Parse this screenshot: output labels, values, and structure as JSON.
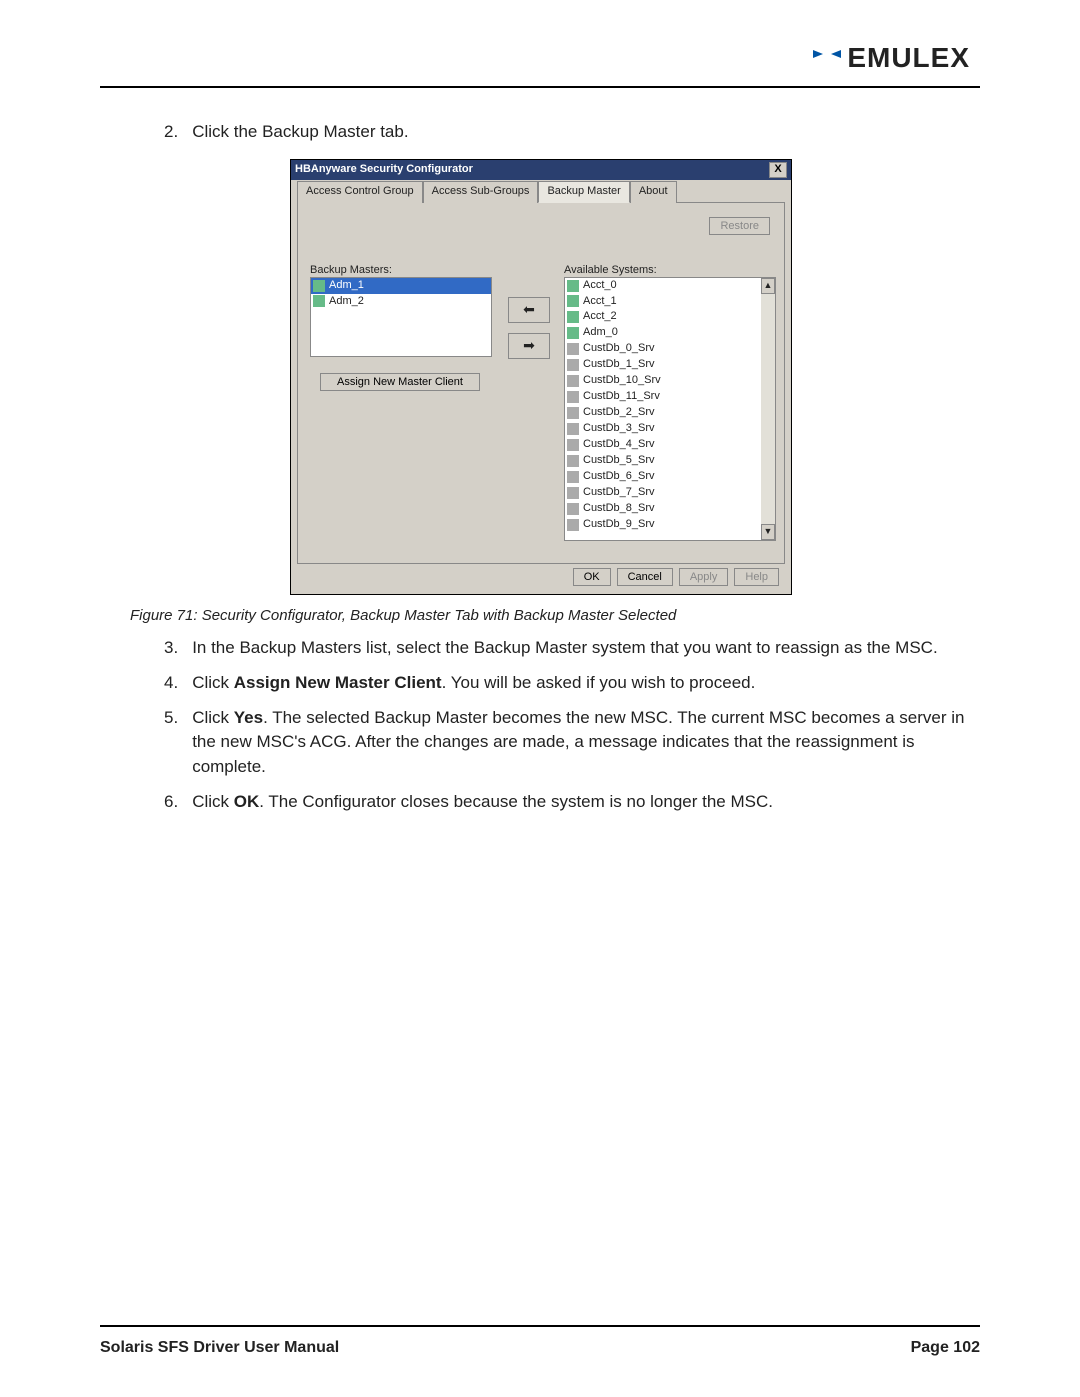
{
  "brand": "EMULEX",
  "step2": {
    "num": "2.",
    "text": "Click the Backup Master tab."
  },
  "dialog": {
    "title": "HBAnyware Security Configurator",
    "close": "X",
    "tabs": [
      "Access Control Group",
      "Access Sub-Groups",
      "Backup Master",
      "About"
    ],
    "active_tab": 2,
    "restore": "Restore",
    "label_backup": "Backup Masters:",
    "label_avail": "Available Systems:",
    "backup_items": [
      "Adm_1",
      "Adm_2"
    ],
    "backup_selected": 0,
    "available_items": [
      "Acct_0",
      "Acct_1",
      "Acct_2",
      "Adm_0",
      "CustDb_0_Srv",
      "CustDb_1_Srv",
      "CustDb_10_Srv",
      "CustDb_11_Srv",
      "CustDb_2_Srv",
      "CustDb_3_Srv",
      "CustDb_4_Srv",
      "CustDb_5_Srv",
      "CustDb_6_Srv",
      "CustDb_7_Srv",
      "CustDb_8_Srv",
      "CustDb_9_Srv"
    ],
    "assign": "Assign New Master Client",
    "ok": "OK",
    "cancel": "Cancel",
    "apply": "Apply",
    "help": "Help"
  },
  "caption": "Figure 71: Security Configurator, Backup Master Tab with Backup Master Selected",
  "steps": {
    "s3": {
      "num": "3.",
      "text": "In the Backup Masters list, select the Backup Master system that you want to reassign as the MSC."
    },
    "s4": {
      "num": "4.",
      "pre": "Click ",
      "bold": "Assign New Master Client",
      "post": ". You will be asked if you wish to proceed."
    },
    "s5": {
      "num": "5.",
      "pre": "Click ",
      "bold": "Yes",
      "post": ". The selected Backup Master becomes the new MSC. The current MSC becomes a server in the new MSC's ACG. After the changes are made, a message indicates that the reassignment is complete."
    },
    "s6": {
      "num": "6.",
      "pre": "Click ",
      "bold": "OK",
      "post": ". The Configurator closes because the system is no longer the MSC."
    }
  },
  "footer": {
    "left": "Solaris SFS Driver User Manual",
    "right": "Page 102"
  }
}
